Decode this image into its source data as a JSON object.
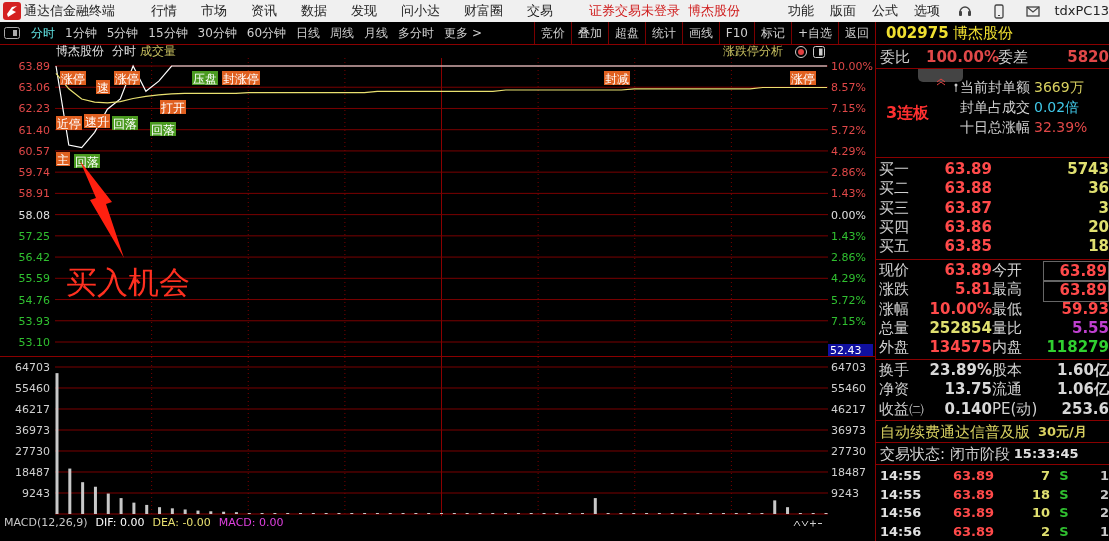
{
  "menubar": {
    "app_title": "通达信金融终端",
    "menus": [
      "行情",
      "市场",
      "资讯",
      "数据",
      "发现",
      "问小达",
      "财富圈",
      "交易"
    ],
    "notices": [
      "证券交易未登录",
      "博杰股份"
    ],
    "tools": [
      "功能",
      "版面",
      "公式",
      "选项"
    ],
    "user": "tdxPC13"
  },
  "period_tabs": [
    {
      "label": "分时",
      "selected": true
    },
    {
      "label": "1分钟",
      "selected": false
    },
    {
      "label": "5分钟",
      "selected": false
    },
    {
      "label": "15分钟",
      "selected": false
    },
    {
      "label": "30分钟",
      "selected": false
    },
    {
      "label": "60分钟",
      "selected": false
    },
    {
      "label": "日线",
      "selected": false
    },
    {
      "label": "周线",
      "selected": false
    },
    {
      "label": "月线",
      "selected": false
    },
    {
      "label": "多分时",
      "selected": false
    },
    {
      "label": "更多 >",
      "selected": false
    }
  ],
  "chart_tools": [
    "竞价",
    "叠加",
    "超盘",
    "统计",
    "画线",
    "F10",
    "标记",
    "+自选",
    "返回"
  ],
  "chart_header": {
    "stock": "博杰股份",
    "mode": "分时",
    "indicator": "成交量",
    "analysis": "涨跌停分析"
  },
  "price_chart": {
    "chart_data": {
      "type": "line",
      "categories": [
        null,
        null,
        null,
        null,
        null,
        null,
        null,
        null,
        null,
        null,
        null,
        null,
        null,
        null,
        null,
        null,
        null,
        null,
        null,
        null,
        null,
        null,
        null,
        null,
        null,
        null,
        null,
        null,
        null,
        null,
        null,
        null,
        null,
        null,
        null,
        null,
        null,
        null,
        null,
        null,
        null,
        null,
        null,
        null,
        null,
        null,
        null,
        null,
        null,
        null,
        null,
        null,
        null,
        null,
        null,
        null,
        null,
        null,
        null,
        null,
        null
      ],
      "series": [
        {
          "color": "#ffffff",
          "values": [
            63.89,
            60.8,
            60.7,
            61.3,
            62.2,
            62.6,
            63.89,
            62.9,
            63.3,
            63.89,
            63.89,
            63.89,
            63.89,
            63.89,
            63.89,
            63.89,
            63.89,
            63.89,
            63.89,
            63.89,
            63.89,
            63.89,
            63.89,
            63.89,
            63.89,
            63.89,
            63.89,
            63.89,
            63.89,
            63.89,
            63.89,
            63.89,
            63.89,
            63.89,
            63.89,
            63.89,
            63.89,
            63.89,
            63.89,
            63.89,
            63.89,
            63.89,
            63.89,
            63.89,
            63.89,
            63.89,
            63.89,
            63.89,
            63.89,
            63.89,
            63.89,
            63.89,
            63.89,
            63.89,
            63.89,
            63.89,
            63.89,
            63.89,
            63.89,
            63.89,
            63.89
          ]
        },
        {
          "color": "#e8e070",
          "values": [
            63.6,
            63.0,
            62.6,
            62.48,
            62.45,
            62.5,
            62.62,
            62.7,
            62.76,
            62.8,
            62.82,
            62.82,
            62.82,
            62.82,
            62.82,
            62.85,
            62.85,
            62.85,
            62.85,
            62.85,
            62.85,
            62.85,
            62.85,
            62.85,
            62.85,
            62.9,
            62.9,
            62.9,
            62.9,
            62.9,
            62.9,
            62.9,
            62.9,
            62.9,
            62.9,
            62.95,
            62.95,
            62.95,
            62.95,
            62.95,
            62.95,
            62.95,
            62.95,
            62.95,
            62.95,
            63.0,
            63.0,
            63.0,
            63.0,
            63.0,
            63.0,
            63.0,
            63.0,
            63.0,
            63.0,
            63.05,
            63.05,
            63.05,
            63.05,
            63.05,
            63.05
          ]
        }
      ],
      "ylim": [
        53.1,
        63.89
      ],
      "grid": true,
      "yticks": [
        {
          "value": 63.89,
          "label": "63.89"
        },
        {
          "value": 63.06,
          "label": "63.06"
        },
        {
          "value": 62.23,
          "label": "62.23"
        },
        {
          "value": 61.4,
          "label": "61.40"
        },
        {
          "value": 60.57,
          "label": "60.57"
        },
        {
          "value": 59.74,
          "label": "59.74"
        },
        {
          "value": 58.91,
          "label": "58.91"
        },
        {
          "value": 58.08,
          "label": "58.08"
        },
        {
          "value": 57.25,
          "label": "57.25"
        },
        {
          "value": 56.42,
          "label": "56.42"
        },
        {
          "value": 55.59,
          "label": "55.59"
        },
        {
          "value": 54.76,
          "label": "54.76"
        },
        {
          "value": 53.93,
          "label": "53.93"
        },
        {
          "value": 53.1,
          "label": "53.10"
        }
      ]
    },
    "percent_ticks": [
      "10.00%",
      "8.57%",
      "7.15%",
      "5.72%",
      "4.29%",
      "2.86%",
      "1.43%",
      "0.00%",
      "1.43%",
      "2.86%",
      "4.29%",
      "5.72%",
      "7.15%"
    ],
    "cursor_readout": "52.43",
    "signal_tags": [
      {
        "text": "涨停",
        "kind": "rise"
      },
      {
        "text": "近停",
        "kind": "rise"
      },
      {
        "text": "速升",
        "kind": "rise"
      },
      {
        "text": "主",
        "kind": "rise"
      },
      {
        "text": "回落",
        "kind": "fall"
      },
      {
        "text": "速",
        "kind": "rise"
      },
      {
        "text": "回落",
        "kind": "fall"
      },
      {
        "text": "回落",
        "kind": "fall"
      },
      {
        "text": "涨停",
        "kind": "rise"
      },
      {
        "text": "打开",
        "kind": "rise"
      },
      {
        "text": "压盘",
        "kind": "fall"
      },
      {
        "text": "封涨停",
        "kind": "rise"
      },
      {
        "text": "封减",
        "kind": "rise"
      },
      {
        "text": "涨停",
        "kind": "rise"
      }
    ]
  },
  "callout": {
    "text": "买入机会"
  },
  "volume_chart": {
    "chart_data": {
      "type": "bar",
      "categories": [
        null,
        null,
        null,
        null,
        null,
        null,
        null,
        null,
        null,
        null,
        null,
        null,
        null,
        null,
        null,
        null,
        null,
        null,
        null,
        null,
        null,
        null,
        null,
        null,
        null,
        null,
        null,
        null,
        null,
        null,
        null,
        null,
        null,
        null,
        null,
        null,
        null,
        null,
        null,
        null,
        null,
        null,
        null,
        null,
        null,
        null,
        null,
        null,
        null,
        null,
        null,
        null,
        null,
        null,
        null,
        null,
        null,
        null,
        null,
        null,
        null
      ],
      "series": [
        {
          "color": "#c8c8c8",
          "values": [
            62000,
            20000,
            14000,
            12000,
            9000,
            7000,
            5000,
            4000,
            3000,
            2500,
            2000,
            1500,
            1200,
            1000,
            800,
            300,
            300,
            300,
            300,
            300,
            300,
            300,
            300,
            300,
            300,
            300,
            300,
            300,
            300,
            300,
            300,
            300,
            300,
            300,
            300,
            300,
            300,
            300,
            300,
            300,
            300,
            300,
            7000,
            300,
            300,
            300,
            300,
            300,
            300,
            300,
            300,
            300,
            300,
            300,
            300,
            300,
            6000,
            3000,
            300,
            300,
            300
          ]
        }
      ],
      "ylim": [
        0,
        64703
      ],
      "grid": true,
      "yticks": [
        {
          "value": 64703,
          "label": "64703"
        },
        {
          "value": 55460,
          "label": "55460"
        },
        {
          "value": 46217,
          "label": "46217"
        },
        {
          "value": 36973,
          "label": "36973"
        },
        {
          "value": 27730,
          "label": "27730"
        },
        {
          "value": 18487,
          "label": "18487"
        },
        {
          "value": 9243,
          "label": "9243"
        }
      ]
    },
    "right_ticks": [
      "64703",
      "55460",
      "46217",
      "36973",
      "27730",
      "18487",
      "9243"
    ]
  },
  "indicator_bar": [
    {
      "text": "MACD(12,26,9)",
      "color": "#c8c8c8"
    },
    {
      "text": "DIF: 0.00",
      "color": "#ffffff"
    },
    {
      "text": "DEA: -0.00",
      "color": "#e8e070"
    },
    {
      "text": "MACD: 0.00",
      "color": "#e040e0"
    }
  ],
  "quote_panel": {
    "code": "002975",
    "name": "博杰股份",
    "order_ratio": {
      "label": "委比",
      "value": "100.00%",
      "label2": "委差",
      "value2": "5820"
    },
    "limit_info": {
      "streak": "3连板",
      "lines": [
        {
          "label": "当前封单额",
          "value": "3669万",
          "color": "#d8d060"
        },
        {
          "label": "封单占成交",
          "value": "0.02倍",
          "color": "#40c8e8"
        },
        {
          "label": "十日总涨幅",
          "value": "32.39%",
          "color": "#e04848"
        }
      ]
    },
    "bids": [
      {
        "label": "买一",
        "price": "63.89",
        "volume": "5743"
      },
      {
        "label": "买二",
        "price": "63.88",
        "volume": "36"
      },
      {
        "label": "买三",
        "price": "63.87",
        "volume": "3"
      },
      {
        "label": "买四",
        "price": "63.86",
        "volume": "20"
      },
      {
        "label": "买五",
        "price": "63.85",
        "volume": "18"
      }
    ],
    "stats": [
      {
        "left": {
          "label": "现价",
          "value": "63.89",
          "color": "#ff4a4a"
        },
        "right": {
          "label": "今开",
          "value": "63.89",
          "color": "#ff4a4a",
          "boxed": true
        }
      },
      {
        "left": {
          "label": "涨跌",
          "value": "5.81",
          "color": "#ff4a4a"
        },
        "right": {
          "label": "最高",
          "value": "63.89",
          "color": "#ff4a4a",
          "boxed": true
        }
      },
      {
        "left": {
          "label": "涨幅",
          "value": "10.00%",
          "color": "#ff4a4a"
        },
        "right": {
          "label": "最低",
          "value": "59.93",
          "color": "#ff4a4a",
          "boxed": false
        }
      },
      {
        "left": {
          "label": "总量",
          "value": "252854",
          "color": "#e0e070"
        },
        "right": {
          "label": "量比",
          "value": "5.55",
          "color": "#c040d0",
          "boxed": false
        }
      },
      {
        "left": {
          "label": "外盘",
          "value": "134575",
          "color": "#ff4a4a"
        },
        "right": {
          "label": "内盘",
          "value": "118279",
          "color": "#30d030",
          "boxed": false
        }
      }
    ],
    "stats2": [
      {
        "label": "换手",
        "value": "23.89%",
        "label2": "股本",
        "value2": "1.60亿"
      },
      {
        "label": "净资",
        "value": "13.75",
        "label2": "流通",
        "value2": "1.06亿"
      },
      {
        "label": "收益㈡",
        "value": "0.140",
        "label2": "PE(动)",
        "value2": "253.6"
      }
    ],
    "promo": {
      "text": "自动续费通达信普及版",
      "price": "30元/月"
    },
    "status": {
      "label": "交易状态: 闭市阶段",
      "time": "15:33:45"
    },
    "ticks": [
      {
        "time": "14:55",
        "price": "63.89",
        "volume": "7",
        "side": "S",
        "count": "1"
      },
      {
        "time": "14:55",
        "price": "63.89",
        "volume": "18",
        "side": "S",
        "count": "2"
      },
      {
        "time": "14:56",
        "price": "63.89",
        "volume": "10",
        "side": "S",
        "count": "2"
      },
      {
        "time": "14:56",
        "price": "63.89",
        "volume": "2",
        "side": "S",
        "count": "1"
      }
    ]
  }
}
